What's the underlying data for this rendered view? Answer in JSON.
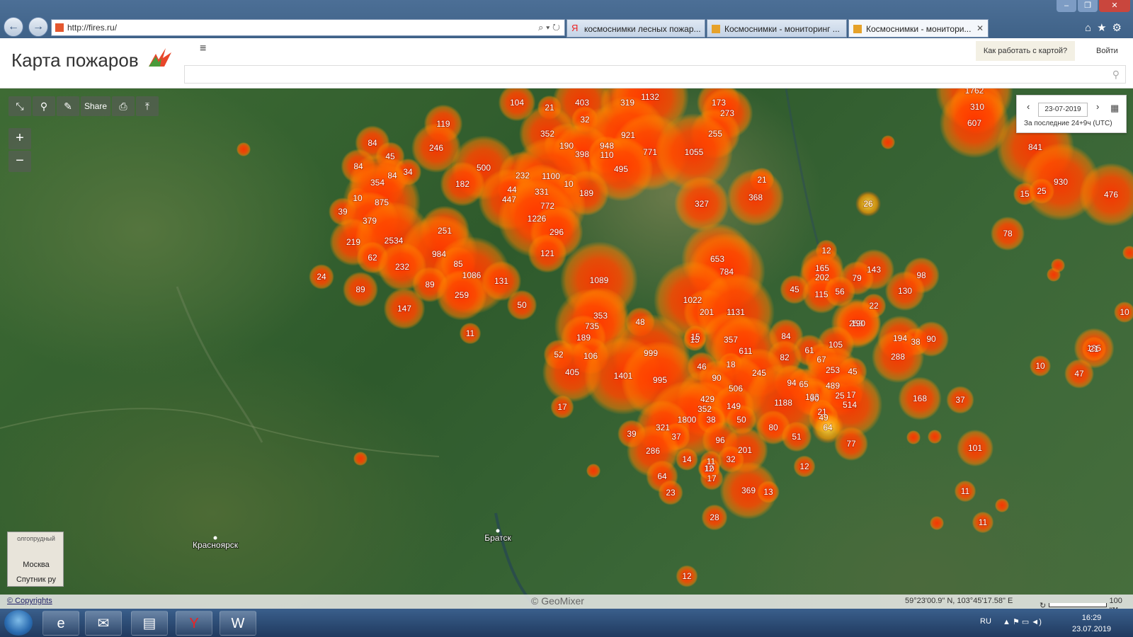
{
  "browser": {
    "url": "http://fires.ru/",
    "tabs": [
      {
        "label": "космоснимки лесных пожар...",
        "icon": "yandex-icon",
        "active": false
      },
      {
        "label": "Космоснимки - мониторинг ...",
        "icon": "fires-icon",
        "active": false
      },
      {
        "label": "Космоснимки - монитори...",
        "icon": "fires-icon",
        "active": true
      }
    ]
  },
  "header": {
    "title": "Карта пожаров",
    "menu_icon": "hamburger-icon",
    "howto_label": "Как работать с картой?",
    "login_label": "Войти",
    "search_placeholder": ""
  },
  "toolbar": {
    "share_label": "Share",
    "icons": [
      "collapse-icon",
      "search-icon",
      "pin-icon",
      "share",
      "print-icon",
      "upload-icon"
    ]
  },
  "zoom": {
    "in_label": "+",
    "out_label": "−"
  },
  "datepanel": {
    "date": "23-07-2019",
    "range": "За последние 24+9ч (UTC)"
  },
  "layers": {
    "top_label": "Москва",
    "bottom_label": "Спутник ру",
    "corner_label": "олгопрудный"
  },
  "cities": [
    {
      "name": "Красноярск"
    },
    {
      "name": "Братск"
    }
  ],
  "fires": [
    {
      "v": "104"
    },
    {
      "v": "21"
    },
    {
      "v": "403"
    },
    {
      "v": "319"
    },
    {
      "v": "1132"
    },
    {
      "v": "173"
    },
    {
      "v": "273"
    },
    {
      "v": "1762"
    },
    {
      "v": "310"
    },
    {
      "v": "607"
    },
    {
      "v": "119"
    },
    {
      "v": "84"
    },
    {
      "v": "45"
    },
    {
      "v": "246"
    },
    {
      "v": "32"
    },
    {
      "v": "352"
    },
    {
      "v": "190"
    },
    {
      "v": "948"
    },
    {
      "v": "921"
    },
    {
      "v": "398"
    },
    {
      "v": "110"
    },
    {
      "v": "771"
    },
    {
      "v": "255"
    },
    {
      "v": "1055"
    },
    {
      "v": "841"
    },
    {
      "v": "84"
    },
    {
      "v": "84"
    },
    {
      "v": "34"
    },
    {
      "v": "500"
    },
    {
      "v": "232"
    },
    {
      "v": "1100"
    },
    {
      "v": "495"
    },
    {
      "v": "354"
    },
    {
      "v": "182"
    },
    {
      "v": "44"
    },
    {
      "v": "10"
    },
    {
      "v": "331"
    },
    {
      "v": "189"
    },
    {
      "v": "21"
    },
    {
      "v": "930"
    },
    {
      "v": "447"
    },
    {
      "v": "368"
    },
    {
      "v": "15"
    },
    {
      "v": "25"
    },
    {
      "v": "476"
    },
    {
      "v": "10"
    },
    {
      "v": "875"
    },
    {
      "v": "772"
    },
    {
      "v": "327"
    },
    {
      "v": "26"
    },
    {
      "v": "39"
    },
    {
      "v": "379"
    },
    {
      "v": "1226"
    },
    {
      "v": "251"
    },
    {
      "v": "296"
    },
    {
      "v": "78"
    },
    {
      "v": "219"
    },
    {
      "v": "2534"
    },
    {
      "v": "653"
    },
    {
      "v": "12"
    },
    {
      "v": "984"
    },
    {
      "v": "121"
    },
    {
      "v": "165"
    },
    {
      "v": "62"
    },
    {
      "v": "232"
    },
    {
      "v": "85"
    },
    {
      "v": "784"
    },
    {
      "v": "202"
    },
    {
      "v": "143"
    },
    {
      "v": "79"
    },
    {
      "v": "24"
    },
    {
      "v": "1086"
    },
    {
      "v": "98"
    },
    {
      "v": "1089"
    },
    {
      "v": "131"
    },
    {
      "v": "89"
    },
    {
      "v": "89"
    },
    {
      "v": "45"
    },
    {
      "v": "115"
    },
    {
      "v": "56"
    },
    {
      "v": "130"
    },
    {
      "v": "259"
    },
    {
      "v": "1022"
    },
    {
      "v": "22"
    },
    {
      "v": "147"
    },
    {
      "v": "50"
    },
    {
      "v": "353"
    },
    {
      "v": "201"
    },
    {
      "v": "1131"
    },
    {
      "v": "10"
    },
    {
      "v": "735"
    },
    {
      "v": "48"
    },
    {
      "v": "253"
    },
    {
      "v": "190"
    },
    {
      "v": "11"
    },
    {
      "v": "189"
    },
    {
      "v": "15"
    },
    {
      "v": "357"
    },
    {
      "v": "84"
    },
    {
      "v": "194"
    },
    {
      "v": "38"
    },
    {
      "v": "90"
    },
    {
      "v": "105"
    },
    {
      "v": "135"
    },
    {
      "v": "21"
    },
    {
      "v": "52"
    },
    {
      "v": "106"
    },
    {
      "v": "999"
    },
    {
      "v": "611"
    },
    {
      "v": "61"
    },
    {
      "v": "82"
    },
    {
      "v": "67"
    },
    {
      "v": "288"
    },
    {
      "v": "46"
    },
    {
      "v": "18"
    },
    {
      "v": "253"
    },
    {
      "v": "10"
    },
    {
      "v": "405"
    },
    {
      "v": "1401"
    },
    {
      "v": "90"
    },
    {
      "v": "245"
    },
    {
      "v": "45"
    },
    {
      "v": "47"
    },
    {
      "v": "15"
    },
    {
      "v": "995"
    },
    {
      "v": "94"
    },
    {
      "v": "65"
    },
    {
      "v": "489"
    },
    {
      "v": "506"
    },
    {
      "v": "123"
    },
    {
      "v": "25"
    },
    {
      "v": "17"
    },
    {
      "v": "168"
    },
    {
      "v": "429"
    },
    {
      "v": "90"
    },
    {
      "v": "514"
    },
    {
      "v": "37"
    },
    {
      "v": "17"
    },
    {
      "v": "352"
    },
    {
      "v": "149"
    },
    {
      "v": "1188"
    },
    {
      "v": "21"
    },
    {
      "v": "1800"
    },
    {
      "v": "50"
    },
    {
      "v": "49"
    },
    {
      "v": "321"
    },
    {
      "v": "38"
    },
    {
      "v": "80"
    },
    {
      "v": "64"
    },
    {
      "v": "39"
    },
    {
      "v": "37"
    },
    {
      "v": "51"
    },
    {
      "v": "101"
    },
    {
      "v": "96"
    },
    {
      "v": "77"
    },
    {
      "v": "286"
    },
    {
      "v": "201"
    },
    {
      "v": "32"
    },
    {
      "v": "11"
    },
    {
      "v": "14"
    },
    {
      "v": "12"
    },
    {
      "v": "10"
    },
    {
      "v": "64"
    },
    {
      "v": "17"
    },
    {
      "v": "12"
    },
    {
      "v": "369"
    },
    {
      "v": "13"
    },
    {
      "v": "11"
    },
    {
      "v": "23"
    },
    {
      "v": "28"
    },
    {
      "v": "11"
    },
    {
      "v": "12"
    }
  ],
  "statusbar": {
    "copyrights": "© Copyrights",
    "geomixer": "© GeoMixer",
    "coords": "59°23'00.9\" N, 103°45'17.58\" E",
    "scale": "100 км"
  },
  "taskbar": {
    "lang": "RU",
    "time": "16:29",
    "date": "23.07.2019"
  },
  "colors": {
    "fire_core": "#ff3a00",
    "fire_mid": "#ff6a00",
    "fire_edge": "#ff9a00"
  }
}
